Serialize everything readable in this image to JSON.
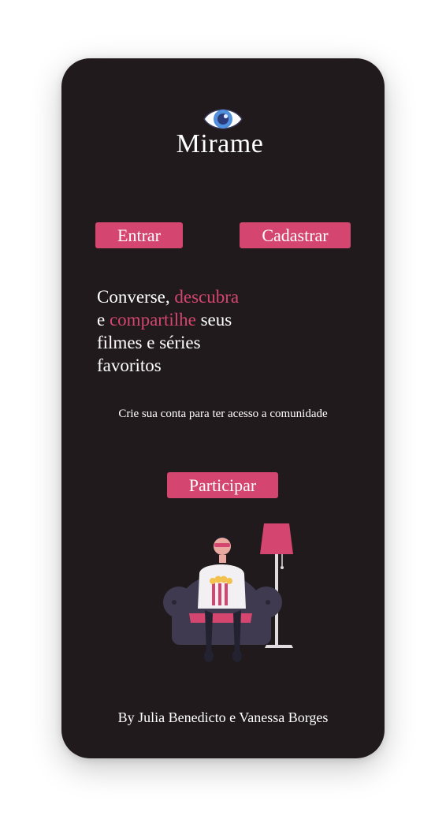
{
  "app": {
    "brand": "Mirame",
    "logo_icon": "eye-icon"
  },
  "nav": {
    "login_label": "Entrar",
    "register_label": "Cadastrar"
  },
  "hero": {
    "line1_plain": "Converse, ",
    "line1_accent": "descubra",
    "line2_plain_start": "e ",
    "line2_accent": "compartilhe",
    "line2_plain_end": " seus",
    "line3": "filmes e séries",
    "line4": "favoritos",
    "subtext": "Crie sua conta para ter acesso a comunidade",
    "join_label": "Participar",
    "illustration": "person-watching-movie-illustration"
  },
  "footer": {
    "credits": "By Julia Benedicto e Vanessa Borges"
  },
  "colors": {
    "background": "#201a1d",
    "accent": "#d4466f",
    "text": "#ffffff"
  }
}
